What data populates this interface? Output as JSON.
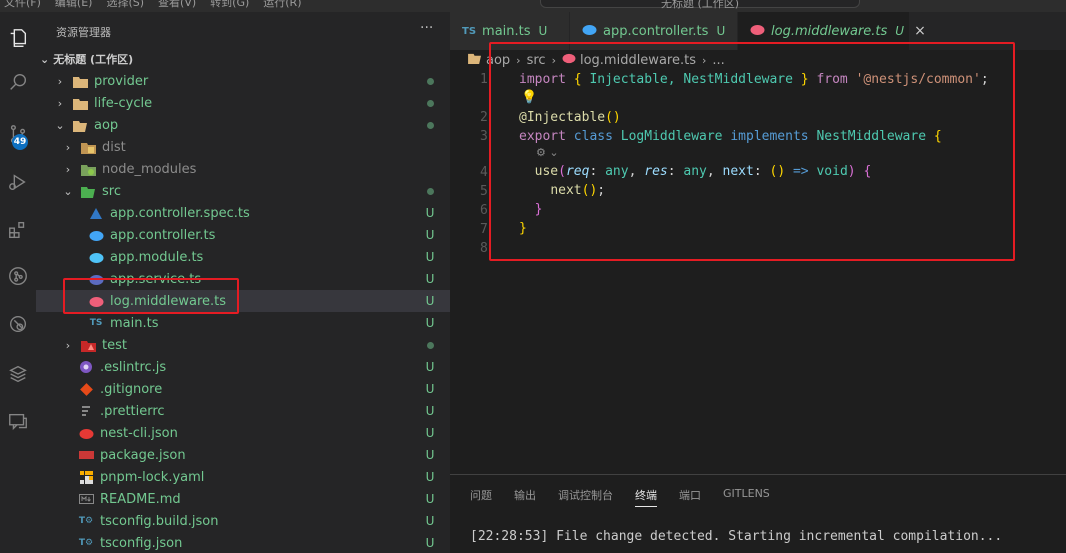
{
  "menu": [
    "文件(F)",
    "编辑(E)",
    "选择(S)",
    "查看(V)",
    "转到(G)",
    "运行(R)"
  ],
  "search_text": "无标题 (工作区)",
  "activity_badge": "49",
  "sidebar": {
    "title": "资源管理器",
    "more": "···",
    "workspace": "无标题 (工作区)",
    "items": [
      {
        "label": "provider",
        "status": "dot"
      },
      {
        "label": "life-cycle",
        "status": "dot"
      },
      {
        "label": "aop",
        "status": "dot"
      },
      {
        "label": "dist",
        "status": ""
      },
      {
        "label": "node_modules",
        "status": ""
      },
      {
        "label": "src",
        "status": "dot"
      },
      {
        "label": "app.controller.spec.ts",
        "status": "U"
      },
      {
        "label": "app.controller.ts",
        "status": "U"
      },
      {
        "label": "app.module.ts",
        "status": "U"
      },
      {
        "label": "app.service.ts",
        "status": "U"
      },
      {
        "label": "log.middleware.ts",
        "status": "U"
      },
      {
        "label": "main.ts",
        "status": "U"
      },
      {
        "label": "test",
        "status": "dot"
      },
      {
        "label": ".eslintrc.js",
        "status": "U"
      },
      {
        "label": ".gitignore",
        "status": "U"
      },
      {
        "label": ".prettierrc",
        "status": "U"
      },
      {
        "label": "nest-cli.json",
        "status": "U"
      },
      {
        "label": "package.json",
        "status": "U"
      },
      {
        "label": "pnpm-lock.yaml",
        "status": "U"
      },
      {
        "label": "README.md",
        "status": "U"
      },
      {
        "label": "tsconfig.build.json",
        "status": "U"
      },
      {
        "label": "tsconfig.json",
        "status": "U"
      }
    ]
  },
  "tabs": [
    {
      "label": "main.ts",
      "status": "U"
    },
    {
      "label": "app.controller.ts",
      "status": "U"
    },
    {
      "label": "log.middleware.ts",
      "status": "U"
    }
  ],
  "breadcrumb": {
    "a": "aop",
    "b": "src",
    "c": "log.middleware.ts",
    "d": "..."
  },
  "code": {
    "l1_import": "import",
    "l1_names": "Injectable, NestMiddleware",
    "l1_from": "from",
    "l1_module": "'@nestjs/common'",
    "decorator": "@Injectable",
    "export": "export",
    "class": "class",
    "classname": "LogMiddleware",
    "implements": "implements",
    "iface": "NestMiddleware",
    "method": "use",
    "p1": "req",
    "p2": "res",
    "p3": "next",
    "any": "any",
    "void": "void",
    "call": "next"
  },
  "line_numbers": [
    "1",
    "",
    "2",
    "3",
    "",
    "4",
    "5",
    "6",
    "7",
    "8"
  ],
  "panel": {
    "tabs": [
      "问题",
      "输出",
      "调试控制台",
      "终端",
      "端口",
      "GITLENS"
    ],
    "active_tab": "终端",
    "terminal_line": "[22:28:53] File change detected. Starting incremental compilation..."
  }
}
